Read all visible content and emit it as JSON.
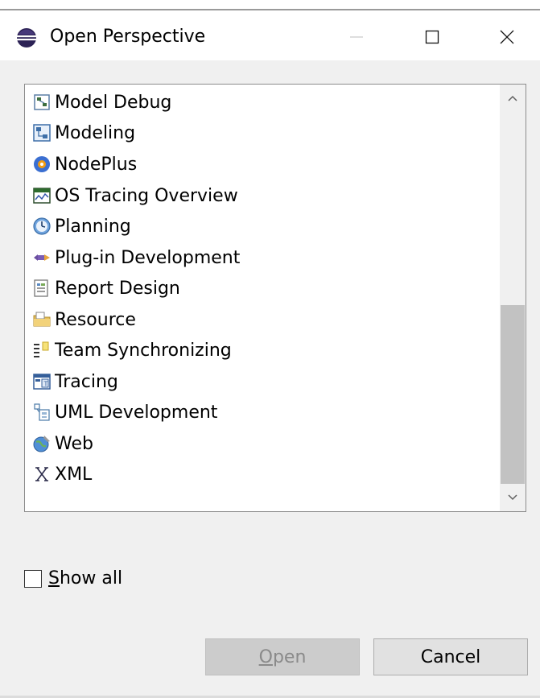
{
  "window": {
    "title": "Open Perspective",
    "controls": [
      "minimize",
      "maximize",
      "close"
    ]
  },
  "perspectives": [
    {
      "label": "Model Debug",
      "icon": "model-debug-icon"
    },
    {
      "label": "Modeling",
      "icon": "modeling-icon"
    },
    {
      "label": "NodePlus",
      "icon": "nodeplus-icon"
    },
    {
      "label": "OS Tracing Overview",
      "icon": "os-tracing-icon"
    },
    {
      "label": "Planning",
      "icon": "planning-icon"
    },
    {
      "label": "Plug-in Development",
      "icon": "plugin-icon"
    },
    {
      "label": "Report Design",
      "icon": "report-design-icon"
    },
    {
      "label": "Resource",
      "icon": "resource-icon"
    },
    {
      "label": "Team Synchronizing",
      "icon": "team-sync-icon"
    },
    {
      "label": "Tracing",
      "icon": "tracing-icon"
    },
    {
      "label": "UML Development",
      "icon": "uml-icon"
    },
    {
      "label": "Web",
      "icon": "web-icon"
    },
    {
      "label": "XML",
      "icon": "xml-icon"
    }
  ],
  "show_all": {
    "label_accel": "S",
    "label_rest": "how all",
    "checked": false
  },
  "buttons": {
    "open_accel": "O",
    "open_rest": "pen",
    "open_enabled": false,
    "cancel": "Cancel"
  },
  "colors": {
    "background": "#f0f0f0",
    "list_background": "#ffffff",
    "disabled_button": "#cccccc",
    "scroll_thumb": "#c2c2c2"
  }
}
